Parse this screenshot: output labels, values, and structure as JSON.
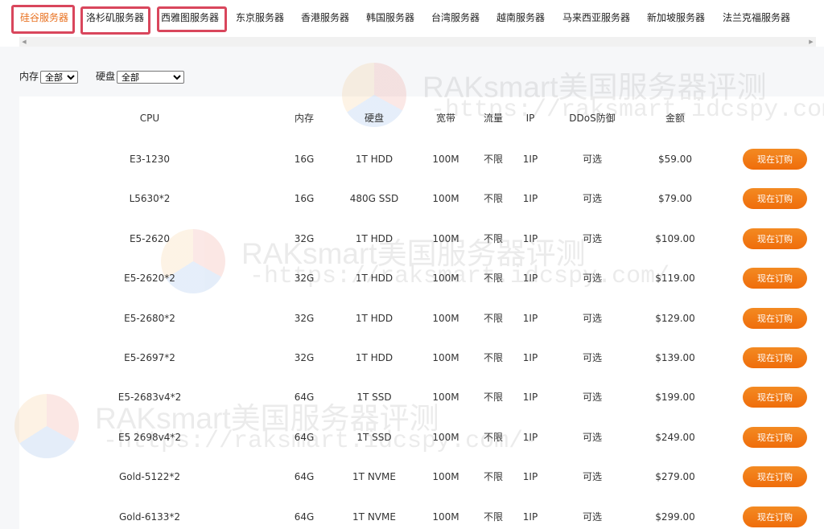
{
  "tabs": [
    {
      "label": "硅谷服务器",
      "active": true
    },
    {
      "label": "洛杉矶服务器",
      "active": false
    },
    {
      "label": "西雅图服务器",
      "active": false
    },
    {
      "label": "东京服务器",
      "active": false
    },
    {
      "label": "香港服务器",
      "active": false
    },
    {
      "label": "韩国服务器",
      "active": false
    },
    {
      "label": "台湾服务器",
      "active": false
    },
    {
      "label": "越南服务器",
      "active": false
    },
    {
      "label": "马来西亚服务器",
      "active": false
    },
    {
      "label": "新加坡服务器",
      "active": false
    },
    {
      "label": "法兰克福服务器",
      "active": false
    }
  ],
  "filters": {
    "memory": {
      "label": "内存",
      "value": "全部"
    },
    "disk": {
      "label": "硬盘",
      "value": "全部"
    }
  },
  "table": {
    "headers": [
      "CPU",
      "内存",
      "硬盘",
      "宽带",
      "流量",
      "IP",
      "DDoS防御",
      "金额"
    ],
    "buy_label": "现在订购",
    "rows": [
      [
        "E3-1230",
        "16G",
        "1T HDD",
        "100M",
        "不限",
        "1IP",
        "可选",
        "$59.00"
      ],
      [
        "L5630*2",
        "16G",
        "480G SSD",
        "100M",
        "不限",
        "1IP",
        "可选",
        "$79.00"
      ],
      [
        "E5-2620",
        "32G",
        "1T HDD",
        "100M",
        "不限",
        "1IP",
        "可选",
        "$109.00"
      ],
      [
        "E5-2620*2",
        "32G",
        "1T HDD",
        "100M",
        "不限",
        "1IP",
        "可选",
        "$119.00"
      ],
      [
        "E5-2680*2",
        "32G",
        "1T HDD",
        "100M",
        "不限",
        "1IP",
        "可选",
        "$129.00"
      ],
      [
        "E5-2697*2",
        "32G",
        "1T HDD",
        "100M",
        "不限",
        "1IP",
        "可选",
        "$139.00"
      ],
      [
        "E5-2683v4*2",
        "64G",
        "1T SSD",
        "100M",
        "不限",
        "1IP",
        "可选",
        "$199.00"
      ],
      [
        "E5 2698v4*2",
        "64G",
        "1T SSD",
        "100M",
        "不限",
        "1IP",
        "可选",
        "$249.00"
      ],
      [
        "Gold-5122*2",
        "64G",
        "1T NVME",
        "100M",
        "不限",
        "1IP",
        "可选",
        "$279.00"
      ],
      [
        "Gold-6133*2",
        "64G",
        "1T NVME",
        "100M",
        "不限",
        "1IP",
        "可选",
        "$299.00"
      ]
    ]
  },
  "watermark": {
    "title": "RAKsmart美国服务器评测",
    "url": "-https://raksmart.idcspy.com/-"
  },
  "colors": {
    "accent": "#ef6d0b",
    "highlight_box": "#d9465c",
    "active_tab": "#e8701f"
  }
}
